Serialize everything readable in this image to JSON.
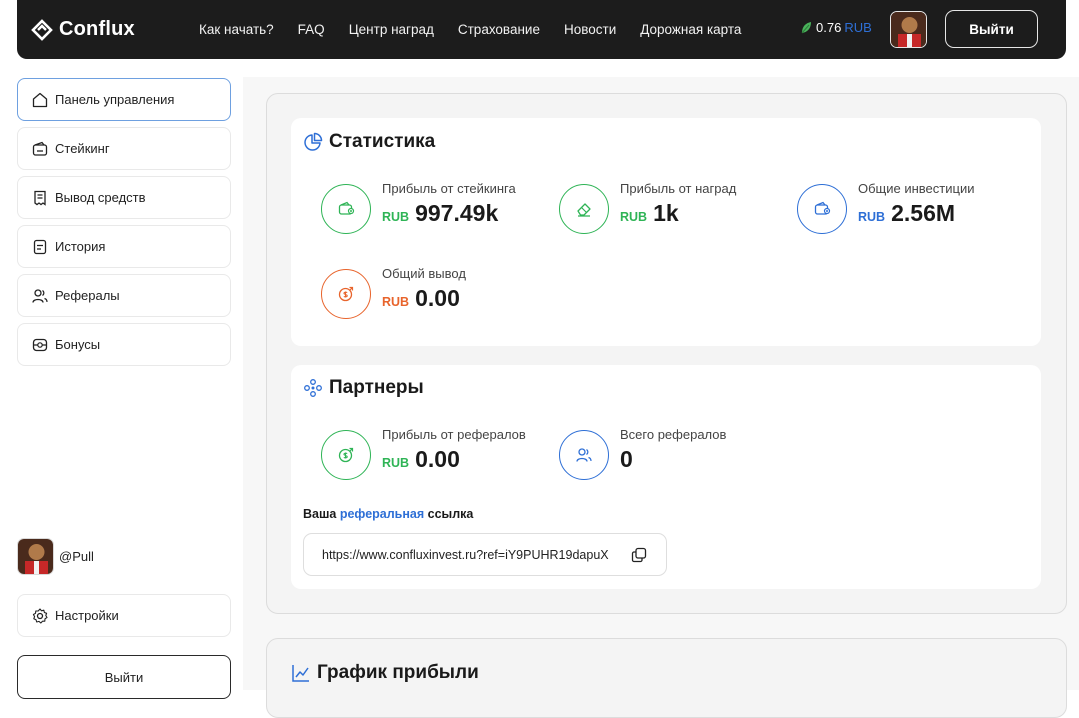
{
  "header": {
    "brand": "Conflux",
    "nav": [
      "Как начать?",
      "FAQ",
      "Центр наград",
      "Страхование",
      "Новости",
      "Дорожная карта"
    ],
    "balance_amount": "0.76",
    "balance_currency": "RUB",
    "logout": "Выйти"
  },
  "sidebar": {
    "items": [
      {
        "label": "Панель управления",
        "icon": "home-icon"
      },
      {
        "label": "Стейкинг",
        "icon": "wallet-icon"
      },
      {
        "label": "Вывод средств",
        "icon": "receipt-icon"
      },
      {
        "label": "История",
        "icon": "document-icon"
      },
      {
        "label": "Рефералы",
        "icon": "users-icon"
      },
      {
        "label": "Бонусы",
        "icon": "bonus-icon"
      }
    ],
    "username": "@Pull",
    "settings": "Настройки",
    "logout": "Выйти"
  },
  "statistics": {
    "title": "Статистика",
    "items": [
      {
        "label": "Прибыль от стейкинга",
        "currency": "RUB",
        "value": "997.49k",
        "color": "#2fb456"
      },
      {
        "label": "Прибыль от наград",
        "currency": "RUB",
        "value": "1k",
        "color": "#2fb456"
      },
      {
        "label": "Общие инвестиции",
        "currency": "RUB",
        "value": "2.56M",
        "color": "#2e6fd6"
      },
      {
        "label": "Общий вывод",
        "currency": "RUB",
        "value": "0.00",
        "color": "#e8642c"
      }
    ]
  },
  "partners": {
    "title": "Партнеры",
    "items": [
      {
        "label": "Прибыль от рефералов",
        "currency": "RUB",
        "value": "0.00",
        "color": "#2fb456"
      },
      {
        "label": "Всего рефералов",
        "value": "0",
        "color": "#2e6fd6"
      }
    ],
    "ref_caption_pre": "Ваша",
    "ref_caption_accent": "реферальная",
    "ref_caption_post": "ссылка",
    "ref_link": "https://www.confluxinvest.ru?ref=iY9PUHR19dapuX"
  },
  "profit_chart": {
    "title": "График прибыли"
  },
  "colors": {
    "accent_blue": "#2e6fd6",
    "accent_green": "#2fb456",
    "accent_orange": "#e8642c",
    "header_bg": "#1c1c1c"
  }
}
